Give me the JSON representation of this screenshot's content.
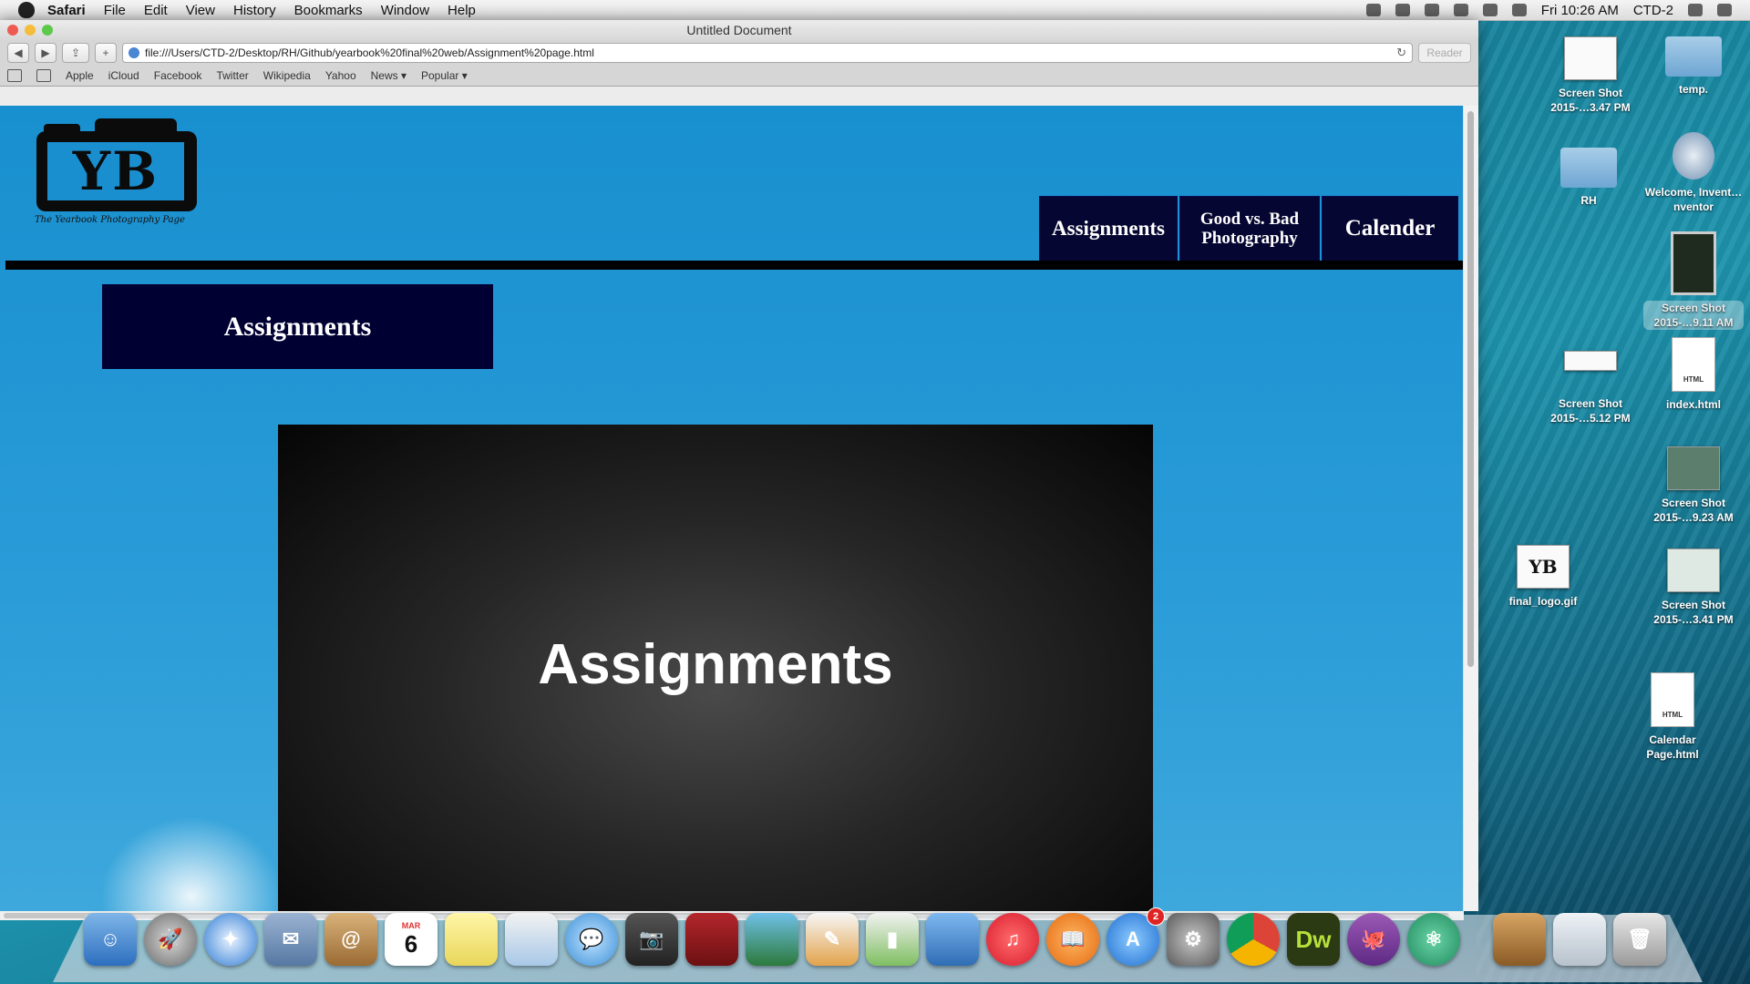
{
  "menubar": {
    "app": "Safari",
    "items": [
      "File",
      "Edit",
      "View",
      "History",
      "Bookmarks",
      "Window",
      "Help"
    ],
    "clock": "Fri 10:26 AM",
    "user": "CTD-2"
  },
  "window": {
    "title": "Untitled Document",
    "url": "file:///Users/CTD-2/Desktop/RH/Github/yearbook%20final%20web/Assignment%20page.html",
    "reader_label": "Reader",
    "bookmarks": [
      "Apple",
      "iCloud",
      "Facebook",
      "Twitter",
      "Wikipedia",
      "Yahoo",
      "News ▾",
      "Popular ▾"
    ]
  },
  "page": {
    "logo_letters": "YB",
    "logo_caption": "The Yearbook Photography Page",
    "nav": [
      "Assignments",
      "Good vs. Bad Photography",
      "Calender"
    ],
    "section_title": "Assignments",
    "slide_text": "Assignments"
  },
  "desktop_icons": [
    {
      "label": "Screen Shot 2015-…3.47 PM",
      "kind": "file"
    },
    {
      "label": "temp.",
      "kind": "folder"
    },
    {
      "label": "RH",
      "kind": "folder"
    },
    {
      "label": "Welcome, Invent…nventor",
      "kind": "app"
    },
    {
      "label": "Screen Shot 2015-…9.11 AM",
      "kind": "file"
    },
    {
      "label": "Screen Shot 2015-…5.12 PM",
      "kind": "file"
    },
    {
      "label": "index.html",
      "kind": "html"
    },
    {
      "label": "Screen Shot 2015-…9.23 AM",
      "kind": "file"
    },
    {
      "label": "final_logo.gif",
      "kind": "file"
    },
    {
      "label": "Screen Shot 2015-…3.41 PM",
      "kind": "file"
    },
    {
      "label": "Calendar Page.html",
      "kind": "html"
    }
  ],
  "dock": {
    "appstore_badge": "2",
    "calendar_day": "6",
    "calendar_month": "MAR",
    "dw_label": "Dw"
  },
  "colors": {
    "page_bg": "#188fcf",
    "nav_bg": "#060632",
    "title_bg": "#000033"
  }
}
